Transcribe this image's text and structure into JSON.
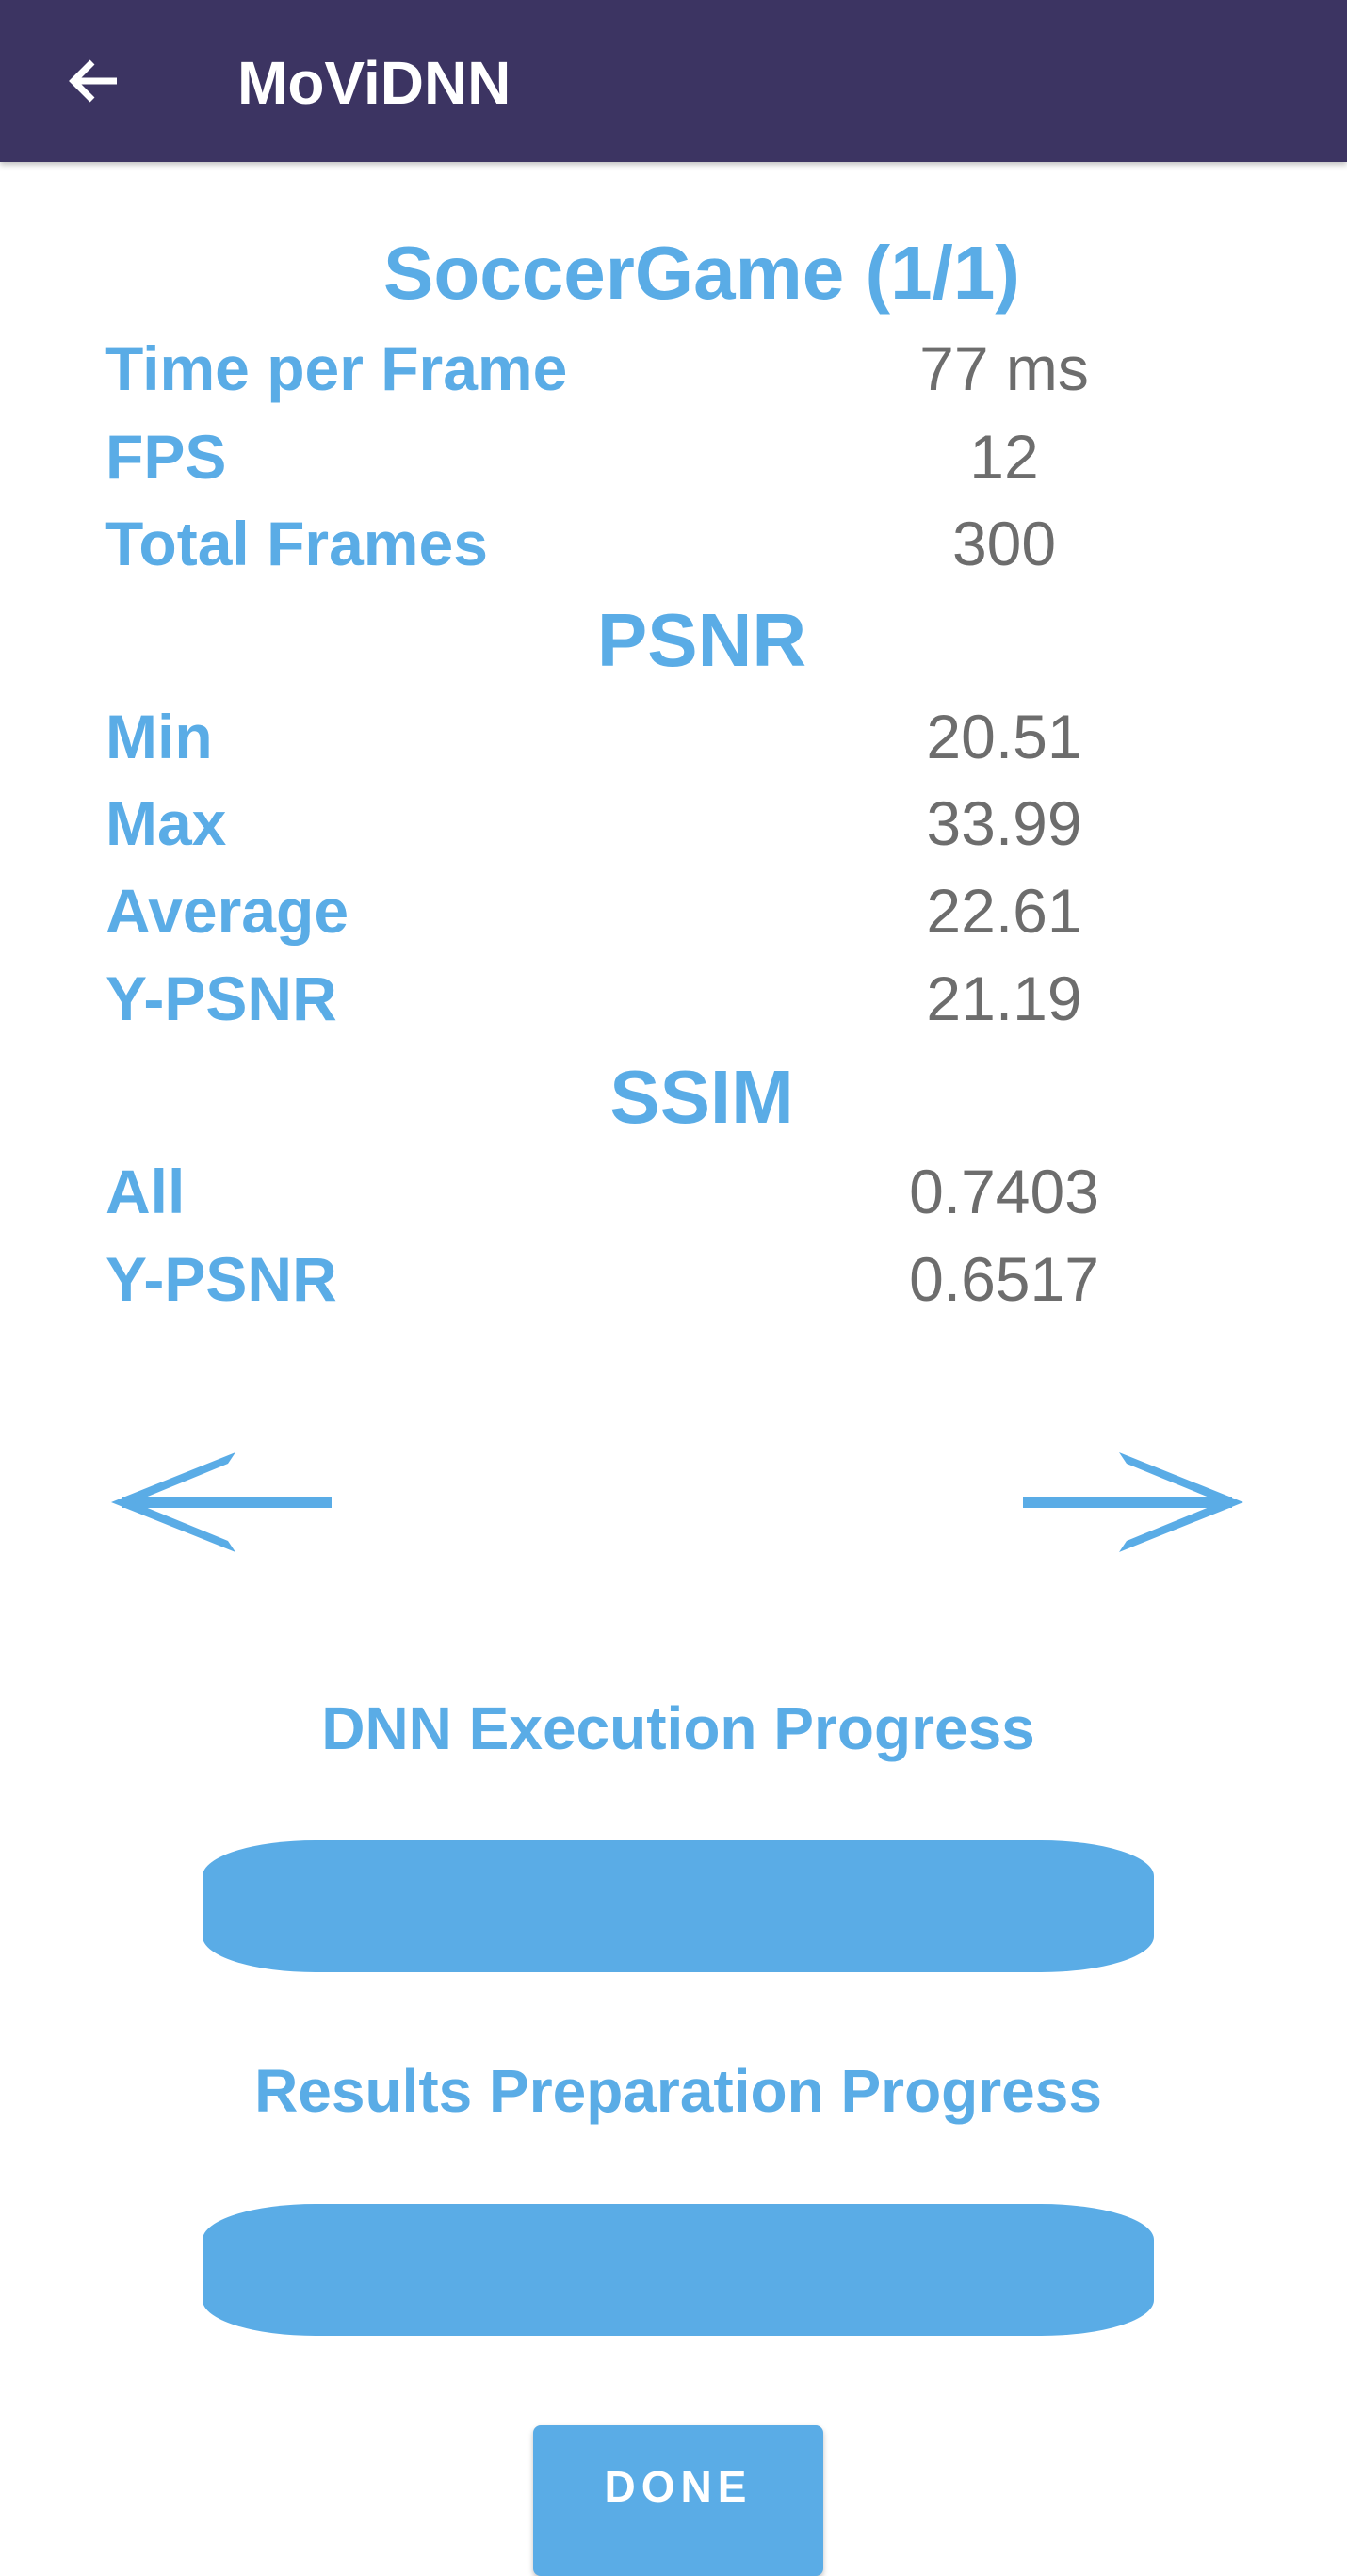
{
  "app_bar": {
    "back_icon": "arrow-left-icon",
    "title": "MoViDNN"
  },
  "video_title": "SoccerGame (1/1)",
  "general": [
    {
      "label": "Time per Frame",
      "value": "77 ms"
    },
    {
      "label": "FPS",
      "value": "12"
    },
    {
      "label": "Total Frames",
      "value": "300"
    }
  ],
  "psnr": {
    "title": "PSNR",
    "rows": [
      {
        "label": "Min",
        "value": "20.51"
      },
      {
        "label": "Max",
        "value": "33.99"
      },
      {
        "label": "Average",
        "value": "22.61"
      },
      {
        "label": "Y-PSNR",
        "value": "21.19"
      }
    ]
  },
  "ssim": {
    "title": "SSIM",
    "rows": [
      {
        "label": "All",
        "value": "0.7403"
      },
      {
        "label": "Y-PSNR",
        "value": "0.6517"
      }
    ]
  },
  "navigation": {
    "prev_icon": "arrow-left-icon",
    "next_icon": "arrow-right-icon"
  },
  "progress": {
    "dnn_label": "DNN Execution Progress",
    "dnn_percent": 100,
    "results_label": "Results Preparation Progress",
    "results_percent": 100
  },
  "done_label": "DONE",
  "colors": {
    "app_bar": "#3c3462",
    "accent": "#5aace6",
    "value_text": "#6d6d6d"
  }
}
